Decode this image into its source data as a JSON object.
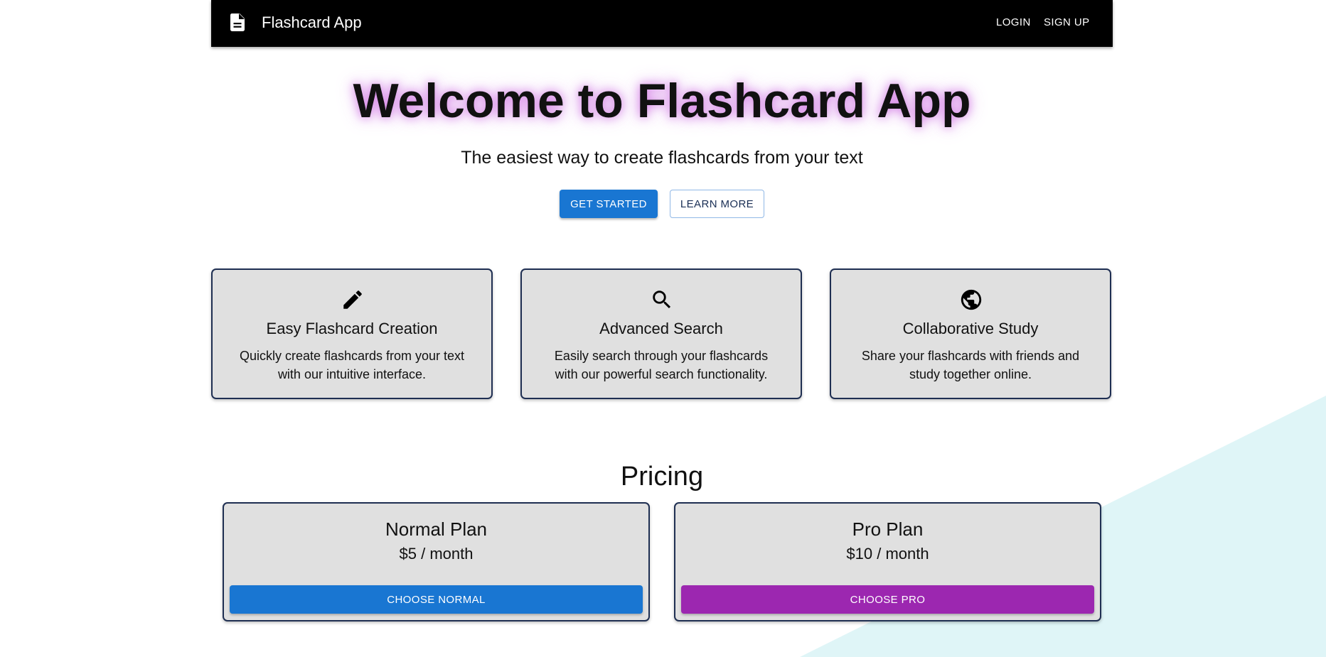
{
  "navbar": {
    "icon": "document-icon",
    "brand": "Flashcard App",
    "login_label": "LOGIN",
    "signup_label": "SIGN UP"
  },
  "hero": {
    "title": "Welcome to Flashcard App",
    "subtitle": "The easiest way to create flashcards from your text",
    "get_started_label": "GET STARTED",
    "learn_more_label": "LEARN MORE",
    "title_glow_color": "#c550dc"
  },
  "features": [
    {
      "icon": "pencil-icon",
      "title": "Easy Flashcard Creation",
      "description": "Quickly create flashcards from your text with our intuitive interface."
    },
    {
      "icon": "search-icon",
      "title": "Advanced Search",
      "description": "Easily search through your flashcards with our powerful search functionality."
    },
    {
      "icon": "globe-icon",
      "title": "Collaborative Study",
      "description": "Share your flashcards with friends and study together online."
    }
  ],
  "pricing": {
    "title": "Pricing",
    "plans": [
      {
        "name": "Normal Plan",
        "price": "$5 / month",
        "button_label": "CHOOSE NORMAL",
        "button_color": "#1976d2"
      },
      {
        "name": "Pro Plan",
        "price": "$10 / month",
        "button_label": "CHOOSE PRO",
        "button_color": "#9c27b0"
      }
    ]
  },
  "colors": {
    "primary": "#1976d2",
    "secondary": "#9c27b0",
    "navbar_bg": "#000000",
    "card_bg": "#e0e0e0",
    "card_border": "#1f2f52",
    "background_accent": "#dff5f7"
  }
}
